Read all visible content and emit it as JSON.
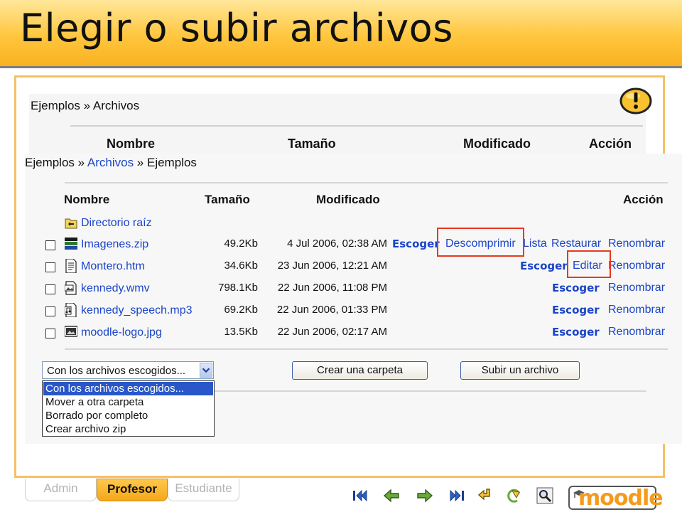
{
  "slide": {
    "title": "Elegir o subir archivos"
  },
  "back": {
    "breadcrumb": "Ejemplos » Archivos",
    "headers": {
      "name": "Nombre",
      "size": "Tamaño",
      "modified": "Modificado",
      "action": "Acción"
    }
  },
  "front": {
    "breadcrumb": {
      "root": "Ejemplos",
      "sep1": " » ",
      "mid": "Archivos",
      "sep2": " » ",
      "current": "Ejemplos"
    },
    "headers": {
      "name": "Nombre",
      "size": "Tamaño",
      "modified": "Modificado",
      "action": "Acción"
    },
    "root_dir": "Directorio raíz",
    "files": [
      {
        "name": "Imagenes.zip",
        "size": "49.2Kb",
        "date": "4 Jul 2006, 02:38 AM",
        "icon": "zip-icon"
      },
      {
        "name": "Montero.htm",
        "size": "34.6Kb",
        "date": "23 Jun 2006, 12:21 AM",
        "icon": "html-file-icon"
      },
      {
        "name": "kennedy.wmv",
        "size": "798.1Kb",
        "date": "22 Jun 2006, 11:08 PM",
        "icon": "video-file-icon"
      },
      {
        "name": "kennedy_speech.mp3",
        "size": "69.2Kb",
        "date": "22 Jun 2006, 01:33 PM",
        "icon": "audio-file-icon"
      },
      {
        "name": "moodle-logo.jpg",
        "size": "13.5Kb",
        "date": "22 Jun 2006, 02:17 AM",
        "icon": "image-file-icon"
      }
    ],
    "actions": {
      "choose": "Escoger",
      "unzip": "Descomprimir",
      "list": "Lista",
      "restore": "Restaurar",
      "rename": "Renombrar",
      "edit": "Editar"
    },
    "select": {
      "value": "Con los archivos escogidos...",
      "options": [
        "Con los archivos escogidos...",
        "Mover a otra carpeta",
        "Borrado por completo",
        "Crear archivo zip"
      ]
    },
    "buttons": {
      "new_folder": "Crear una carpeta",
      "upload": "Subir un archivo"
    }
  },
  "tabs": {
    "admin": "Admin",
    "teacher": "Profesor",
    "student": "Estudiante"
  },
  "logo": {
    "text": "moodle"
  },
  "colors": {
    "accent": "#ffc63e",
    "link": "#1a44c9",
    "highlight": "#e8381f",
    "selected": "#2957c9"
  }
}
